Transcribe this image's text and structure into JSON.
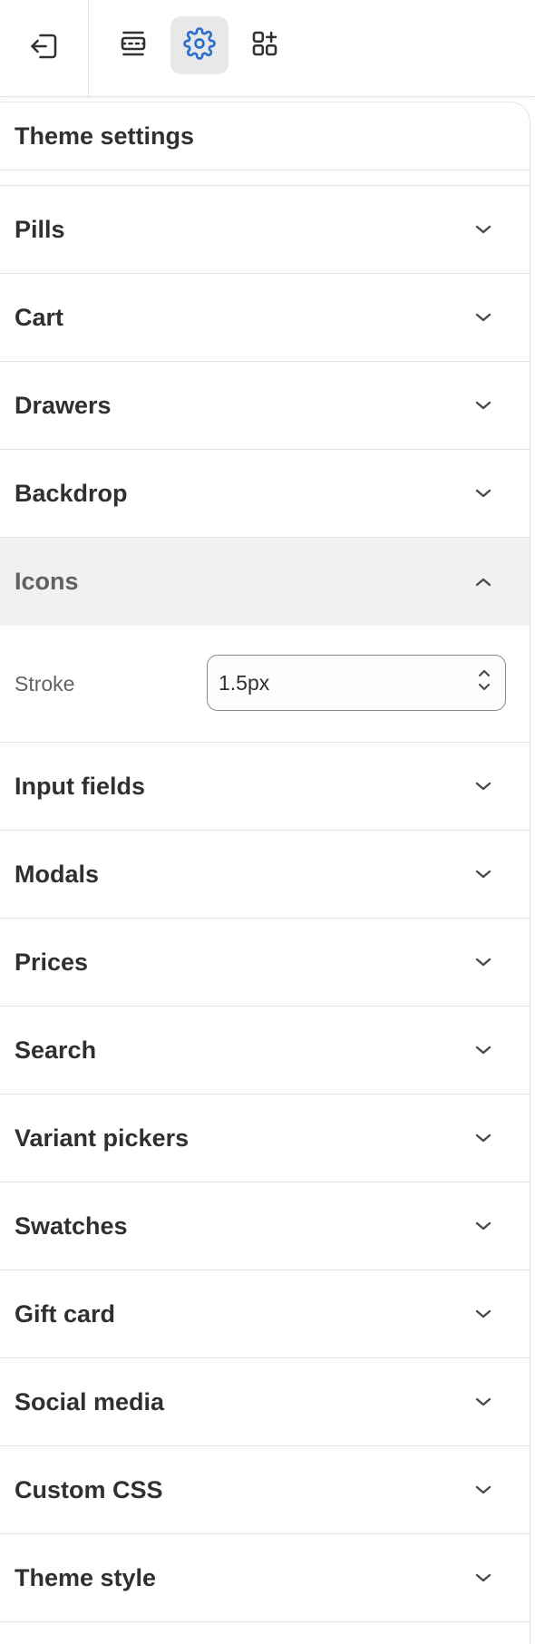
{
  "toolbar": {
    "exit_icon": "exit-icon",
    "tools": [
      {
        "icon": "sections-icon",
        "active": false
      },
      {
        "icon": "settings-gear-icon",
        "active": true
      },
      {
        "icon": "apps-icon",
        "active": false
      }
    ],
    "accent_color": "#2c6ecb"
  },
  "panel": {
    "title": "Theme settings",
    "sections_before": [
      {
        "label": "Pills"
      },
      {
        "label": "Cart"
      },
      {
        "label": "Drawers"
      },
      {
        "label": "Backdrop"
      }
    ],
    "expanded_section": {
      "label": "Icons",
      "setting": {
        "label": "Stroke",
        "value": "1.5px"
      }
    },
    "sections_after": [
      {
        "label": "Input fields"
      },
      {
        "label": "Modals"
      },
      {
        "label": "Prices"
      },
      {
        "label": "Search"
      },
      {
        "label": "Variant pickers"
      },
      {
        "label": "Swatches"
      },
      {
        "label": "Gift card"
      },
      {
        "label": "Social media"
      },
      {
        "label": "Custom CSS"
      },
      {
        "label": "Theme style"
      }
    ]
  }
}
